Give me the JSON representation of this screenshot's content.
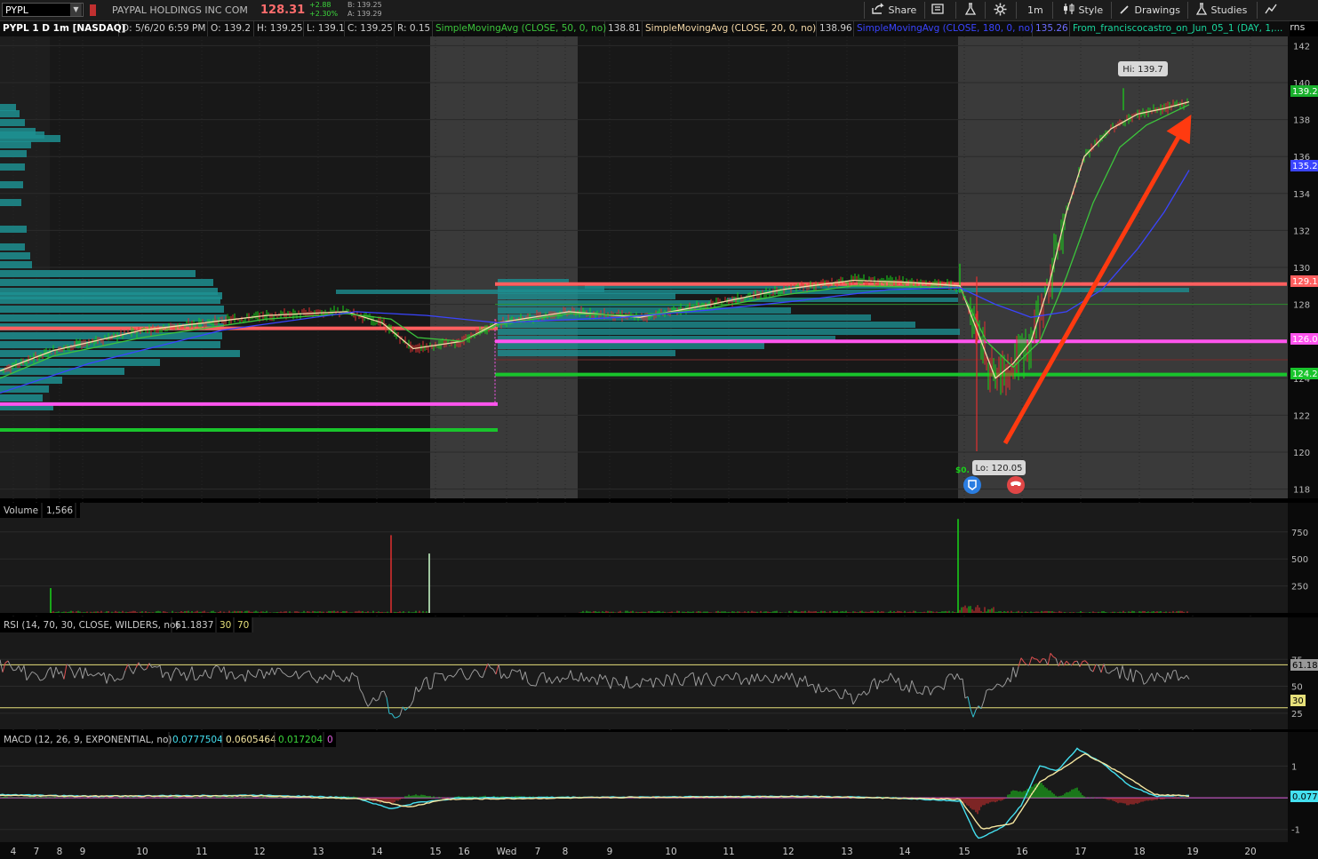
{
  "toolbar": {
    "symbol": "PYPL",
    "company": "PAYPAL HOLDINGS INC COM",
    "last": "128.31",
    "change": "+2.88",
    "change_pct": "+2.30%",
    "bid": "B: 139.25",
    "ask": "A: 139.29",
    "share": "Share",
    "timeframe": "1m",
    "style": "Style",
    "drawings": "Drawings",
    "studies": "Studies",
    "patterns": "Patterns"
  },
  "colors": {
    "up": "#19d419",
    "down": "#e03030",
    "sma20": "#f5d9a8",
    "sma50": "#3cc43c",
    "sma180": "#3a44ff",
    "volume_profile": "#1d8f91",
    "arrow": "#ff3a10",
    "pink_level": "#ff55ee",
    "red_level": "#ff5f5f",
    "green_level": "#19c42c"
  },
  "study_bar": {
    "header": "PYPL 1 D 1m [NASDAQ]",
    "d": "D: 5/6/20 6:59 PM",
    "o": "O: 139.2",
    "h": "H: 139.25",
    "l": "L: 139.1",
    "c": "C: 139.25",
    "r": "R: 0.15",
    "sma50_label": "SimpleMovingAvg (CLOSE, 50, 0, no)",
    "sma50_val": "138.81",
    "sma20_label": "SimpleMovingAvg (CLOSE, 20, 0, no)",
    "sma20_val": "138.96",
    "sma180_label": "SimpleMovingAvg (CLOSE, 180, 0, no)",
    "sma180_val": "135.26",
    "custom": "From_franciscocastro_on_Jun_05_1 (DAY, 1,..."
  },
  "price_labels": {
    "p139": "139.2",
    "p135": "135.2",
    "p129": "129.1",
    "p126": "126.0",
    "p124": "124.2"
  },
  "annotations": {
    "hi": "Hi: 139.7",
    "lo": "Lo: 120.05",
    "tiny": "$0."
  },
  "volume_panel": {
    "label": "Volume",
    "value": "1,566"
  },
  "rsi_panel": {
    "label": "RSI (14, 70, 30, CLOSE, WILDERS, no)",
    "value": "61.1837",
    "os": "30",
    "ob": "70",
    "right_value": "61.18",
    "right_os": "30"
  },
  "macd_panel": {
    "label": "MACD (12, 26, 9, EXPONENTIAL, no)",
    "value": "0.0777504",
    "avg": "0.0605464",
    "diff": "0.017204",
    "zero": "0",
    "right_value": "0.077"
  },
  "chart_data": [
    {
      "type": "line",
      "ylim": [
        117.5,
        142.5
      ],
      "y_ticks": [
        "142",
        "140",
        "138",
        "136",
        "134",
        "132",
        "130",
        "128",
        "124",
        "122",
        "120",
        "118"
      ],
      "x_ticks": [
        "4",
        "7",
        "8",
        "9",
        "10",
        "11",
        "12",
        "13",
        "14",
        "15",
        "16",
        "Wed",
        "7",
        "8",
        "9",
        "10",
        "11",
        "12",
        "13",
        "14",
        "15",
        "16",
        "17",
        "18",
        "19",
        "20"
      ],
      "series": [
        {
          "name": "SimpleMovingAvg (CLOSE, 20, 0, no)",
          "points": [
            [
              0,
              124.4
            ],
            [
              60,
              125.5
            ],
            [
              160,
              126.6
            ],
            [
              300,
              127.4
            ],
            [
              390,
              127.6
            ],
            [
              430,
              127.0
            ],
            [
              465,
              125.6
            ],
            [
              520,
              126.0
            ],
            [
              560,
              127.0
            ],
            [
              640,
              127.6
            ],
            [
              720,
              127.3
            ],
            [
              800,
              128.0
            ],
            [
              880,
              128.8
            ],
            [
              960,
              129.3
            ],
            [
              1020,
              129.2
            ],
            [
              1080,
              129.0
            ],
            [
              1100,
              126.5
            ],
            [
              1120,
              124.0
            ],
            [
              1140,
              124.8
            ],
            [
              1160,
              126.0
            ],
            [
              1180,
              129.0
            ],
            [
              1200,
              133.0
            ],
            [
              1220,
              136.0
            ],
            [
              1250,
              137.5
            ],
            [
              1280,
              138.3
            ],
            [
              1310,
              138.6
            ],
            [
              1338,
              138.96
            ]
          ]
        },
        {
          "name": "SimpleMovingAvg (CLOSE, 50, 0, no)",
          "points": [
            [
              0,
              124.0
            ],
            [
              60,
              125.2
            ],
            [
              160,
              126.2
            ],
            [
              300,
              127.2
            ],
            [
              390,
              127.5
            ],
            [
              440,
              127.2
            ],
            [
              470,
              126.2
            ],
            [
              520,
              126.0
            ],
            [
              560,
              126.9
            ],
            [
              640,
              127.5
            ],
            [
              720,
              127.4
            ],
            [
              800,
              127.8
            ],
            [
              880,
              128.5
            ],
            [
              960,
              129.0
            ],
            [
              1080,
              128.9
            ],
            [
              1110,
              126.0
            ],
            [
              1140,
              124.6
            ],
            [
              1170,
              126.0
            ],
            [
              1200,
              129.5
            ],
            [
              1230,
              133.5
            ],
            [
              1260,
              136.5
            ],
            [
              1290,
              137.7
            ],
            [
              1338,
              138.81
            ]
          ]
        },
        {
          "name": "SimpleMovingAvg (CLOSE, 180, 0, no)",
          "points": [
            [
              0,
              123.2
            ],
            [
              100,
              124.8
            ],
            [
              250,
              126.6
            ],
            [
              400,
              127.6
            ],
            [
              480,
              127.4
            ],
            [
              560,
              127.0
            ],
            [
              700,
              127.3
            ],
            [
              800,
              127.7
            ],
            [
              900,
              128.2
            ],
            [
              1000,
              128.8
            ],
            [
              1080,
              128.9
            ],
            [
              1120,
              128.0
            ],
            [
              1160,
              127.3
            ],
            [
              1200,
              127.6
            ],
            [
              1240,
              128.8
            ],
            [
              1280,
              131.0
            ],
            [
              1310,
              133.0
            ],
            [
              1338,
              135.26
            ]
          ]
        }
      ],
      "levels": [
        {
          "price": 129.1,
          "from": 557,
          "to": 1448,
          "color": "red"
        },
        {
          "price": 126.7,
          "from": 0,
          "to": 560,
          "color": "red"
        },
        {
          "price": 126.0,
          "from": 557,
          "to": 1448,
          "color": "pink"
        },
        {
          "price": 124.2,
          "from": 557,
          "to": 1448,
          "color": "green"
        },
        {
          "price": 122.6,
          "from": 0,
          "to": 560,
          "color": "pink"
        },
        {
          "price": 121.2,
          "from": 0,
          "to": 560,
          "color": "green"
        }
      ]
    },
    {
      "type": "bar",
      "ylim": [
        0,
        880
      ],
      "y_ticks": [
        "750",
        "500",
        "250"
      ],
      "spikes": [
        [
          57,
          230
        ],
        [
          440,
          720
        ],
        [
          483,
          550
        ],
        [
          1078,
          870
        ]
      ]
    },
    {
      "type": "line",
      "ylim": [
        10,
        100
      ],
      "y_ticks": [
        "75",
        "50",
        "25"
      ],
      "points": [
        [
          0,
          70
        ],
        [
          40,
          60
        ],
        [
          80,
          64
        ],
        [
          120,
          58
        ],
        [
          160,
          68
        ],
        [
          200,
          60
        ],
        [
          240,
          64
        ],
        [
          280,
          58
        ],
        [
          320,
          66
        ],
        [
          360,
          58
        ],
        [
          400,
          62
        ],
        [
          410,
          32
        ],
        [
          430,
          45
        ],
        [
          445,
          18
        ],
        [
          460,
          30
        ],
        [
          470,
          48
        ],
        [
          500,
          60
        ],
        [
          560,
          65
        ],
        [
          600,
          55
        ],
        [
          650,
          60
        ],
        [
          700,
          52
        ],
        [
          760,
          58
        ],
        [
          820,
          55
        ],
        [
          880,
          60
        ],
        [
          960,
          40
        ],
        [
          1000,
          58
        ],
        [
          1040,
          45
        ],
        [
          1080,
          60
        ],
        [
          1095,
          22
        ],
        [
          1110,
          40
        ],
        [
          1130,
          55
        ],
        [
          1160,
          78
        ],
        [
          1200,
          72
        ],
        [
          1240,
          68
        ],
        [
          1280,
          58
        ],
        [
          1338,
          61.18
        ]
      ]
    },
    {
      "type": "line",
      "ylim": [
        -1.4,
        1.6
      ],
      "y_ticks": [
        "1",
        "-1"
      ],
      "series": [
        {
          "name": "MACD",
          "points": [
            [
              0,
              0.1
            ],
            [
              100,
              0.05
            ],
            [
              300,
              0.08
            ],
            [
              400,
              0.0
            ],
            [
              440,
              -0.35
            ],
            [
              470,
              -0.15
            ],
            [
              520,
              0.0
            ],
            [
              700,
              0.02
            ],
            [
              900,
              0.05
            ],
            [
              1000,
              0.0
            ],
            [
              1080,
              -0.1
            ],
            [
              1100,
              -1.3
            ],
            [
              1130,
              -0.9
            ],
            [
              1150,
              -0.2
            ],
            [
              1170,
              1.0
            ],
            [
              1190,
              0.85
            ],
            [
              1212,
              1.55
            ],
            [
              1240,
              1.1
            ],
            [
              1270,
              0.4
            ],
            [
              1300,
              0.05
            ],
            [
              1338,
              0.077
            ]
          ]
        },
        {
          "name": "MACD Avg",
          "points": [
            [
              0,
              0.07
            ],
            [
              100,
              0.05
            ],
            [
              300,
              0.06
            ],
            [
              420,
              -0.05
            ],
            [
              460,
              -0.3
            ],
            [
              500,
              -0.05
            ],
            [
              700,
              0.01
            ],
            [
              900,
              0.04
            ],
            [
              1080,
              -0.05
            ],
            [
              1105,
              -1.0
            ],
            [
              1140,
              -0.8
            ],
            [
              1170,
              0.5
            ],
            [
              1200,
              1.0
            ],
            [
              1220,
              1.4
            ],
            [
              1260,
              0.8
            ],
            [
              1300,
              0.1
            ],
            [
              1338,
              0.06
            ]
          ]
        }
      ]
    }
  ]
}
